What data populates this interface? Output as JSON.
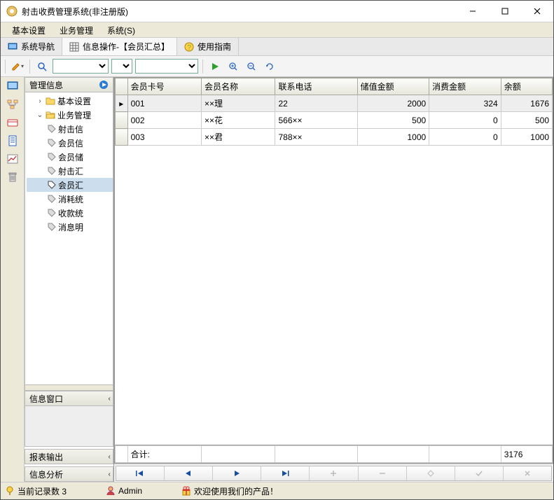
{
  "window": {
    "title": "射击收费管理系统(非注册版)"
  },
  "menu": {
    "items": [
      "基本设置",
      "业务管理",
      "系统(S)"
    ]
  },
  "tabs": {
    "items": [
      {
        "label": "系统导航",
        "active": false
      },
      {
        "label": "信息操作-【会员汇总】",
        "active": true
      },
      {
        "label": "使用指南",
        "active": false
      }
    ]
  },
  "sidebar": {
    "header": "管理信息",
    "tree": {
      "basic": "基本设置",
      "biz": "业务管理",
      "children": [
        "射击信",
        "会员信",
        "会员储",
        "射击汇",
        "会员汇",
        "消耗统",
        "收款统",
        "消息明"
      ]
    },
    "info_window": "信息窗口",
    "report_out": "报表输出",
    "info_analysis": "信息分析"
  },
  "grid": {
    "columns": [
      "会员卡号",
      "会员名称",
      "联系电话",
      "储值金额",
      "消费金额",
      "余额"
    ],
    "rows": [
      {
        "card": "001",
        "name": "××理",
        "phone": "22",
        "deposit": 2000,
        "spend": 324,
        "balance": 1676,
        "sel": true
      },
      {
        "card": "002",
        "name": "××花",
        "phone": "566××",
        "deposit": 500,
        "spend": 0,
        "balance": 500,
        "sel": false
      },
      {
        "card": "003",
        "name": "××君",
        "phone": "788××",
        "deposit": 1000,
        "spend": 0,
        "balance": 1000,
        "sel": false
      }
    ],
    "footer_label": "合计:",
    "footer_total": 3176
  },
  "nav_buttons": [
    "first",
    "prev",
    "next",
    "last",
    "add",
    "remove",
    "edit",
    "ok",
    "cancel"
  ],
  "status": {
    "records_label": "当前记录数 3",
    "user": "Admin",
    "welcome": "欢迎使用我们的产品！"
  }
}
